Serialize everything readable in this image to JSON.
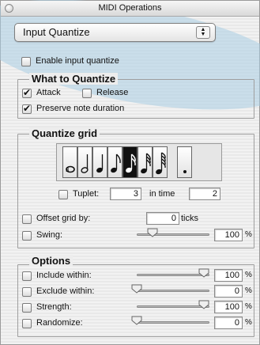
{
  "window": {
    "title": "MIDI Operations"
  },
  "popup": {
    "value": "Input Quantize"
  },
  "enable": {
    "label": "Enable input quantize",
    "checked": false
  },
  "what": {
    "title": "What to Quantize",
    "attack": {
      "label": "Attack",
      "checked": true
    },
    "release": {
      "label": "Release",
      "checked": false
    },
    "preserve": {
      "label": "Preserve note duration",
      "checked": true
    }
  },
  "grid": {
    "title": "Quantize grid",
    "notes": [
      "whole-triplet-note-icon",
      "half-note-icon",
      "quarter-note-icon",
      "eighth-note-icon",
      "sixteenth-note-icon",
      "thirty-second-note-icon",
      "sixty-fourth-note-icon",
      "dot-icon"
    ],
    "selected_note": "sixteenth-note-icon",
    "tuplet": {
      "label": "Tuplet:",
      "checked": false,
      "value": "3",
      "in_time_label": "in time",
      "in_time_value": "2"
    },
    "offset": {
      "label": "Offset grid by:",
      "checked": false,
      "value": "0",
      "unit": "ticks"
    },
    "swing": {
      "label": "Swing:",
      "checked": false,
      "value": "100",
      "unit": "%",
      "level": 0.22
    }
  },
  "options": {
    "title": "Options",
    "rows": [
      {
        "label": "Include within:",
        "value": "100",
        "unit": "%",
        "level": 0.92
      },
      {
        "label": "Exclude within:",
        "value": "0",
        "unit": "%",
        "level": 0.0
      },
      {
        "label": "Strength:",
        "value": "100",
        "unit": "%",
        "level": 0.92
      },
      {
        "label": "Randomize:",
        "value": "0",
        "unit": "%",
        "level": 0.0
      }
    ]
  }
}
